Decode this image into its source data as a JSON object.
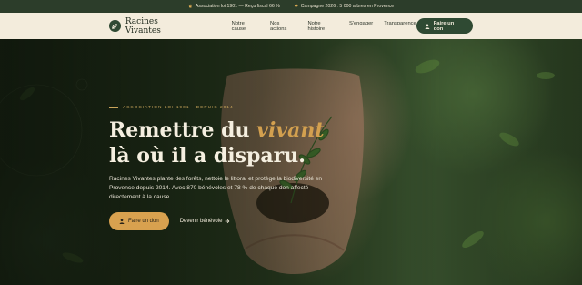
{
  "topbar": {
    "message_1": "Association loi 1901 — Reçu fiscal 66 %",
    "message_2": "Campagne 2026 : 5 000 arbres en Provence",
    "icon_1": "leaf-icon",
    "icon_2": "tree-icon"
  },
  "nav": {
    "logo": "Racines Vivantes",
    "logo_icon": "leaf-icon",
    "items": [
      "Notre cause",
      "Nos actions",
      "Notre histoire",
      "S'engager",
      "Transparence"
    ],
    "donate_label": "Faire un don"
  },
  "hero": {
    "eyebrow": "ASSOCIATION LOI 1901 · DEPUIS 2014",
    "headline_part1": "Remettre du ",
    "headline_emphasis": "vivant",
    "headline_part2": "là où il a disparu.",
    "lede": "Racines Vivantes plante des forêts, nettoie le littoral et protège la biodiversité en Provence depuis 2014. Avec 870 bénévoles et 78 % de chaque don affecté directement à la cause.",
    "cta_primary": "Faire un don",
    "cta_secondary": "Devenir bénévole",
    "cta_secondary_icon": "arrow-right-icon"
  },
  "colors": {
    "primary": "#2f4a33",
    "accent": "#d8a14f",
    "cream": "#f3ecdc"
  }
}
